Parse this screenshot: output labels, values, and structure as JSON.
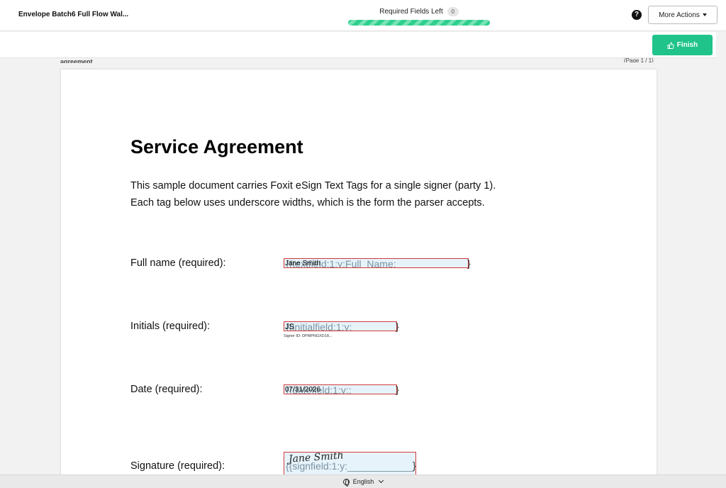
{
  "header": {
    "title": "Envelope Batch6 Full Flow Wal...",
    "required_label": "Required Fields Left",
    "required_count": "0",
    "progress": 1.0,
    "help_icon": "question-circle-icon",
    "more_actions": "More Actions"
  },
  "toolbar": {
    "finish_label": "Finish",
    "finish_icon": "thumbs-up-icon"
  },
  "document": {
    "name": "agreement",
    "page_indicator": "(Page 1 / 1)",
    "heading": "Service Agreement",
    "intro_line1": "This sample document carries Foxit eSign Text Tags for a single signer (party 1).",
    "intro_line2": "Each tag below uses underscore widths, which is the form the parser accepts.",
    "fields": {
      "full_name": {
        "label": "Full name (required):",
        "tag": "{{textfield:1:y:Full_Name:_______________",
        "value": "Jane Smith"
      },
      "initials": {
        "label": "Initials (required):",
        "tag": "{{initialfield:1:y:____________",
        "value": "JS",
        "signer_id": "Signer ID: DPMPNGXD18..."
      },
      "date": {
        "label": "Date (required):",
        "tag": "{{datefield:1:y::____________",
        "value": "07/31/2026"
      },
      "signature": {
        "label": "Signature (required):",
        "tag": "{{signfield:1:y:____________",
        "value": "Jane Smith"
      }
    }
  },
  "footer": {
    "language": "English",
    "globe_icon": "globe-icon"
  },
  "colors": {
    "accent": "#20c38a",
    "field_border": "#d23b3b",
    "field_fill": "#e6f3fb"
  }
}
